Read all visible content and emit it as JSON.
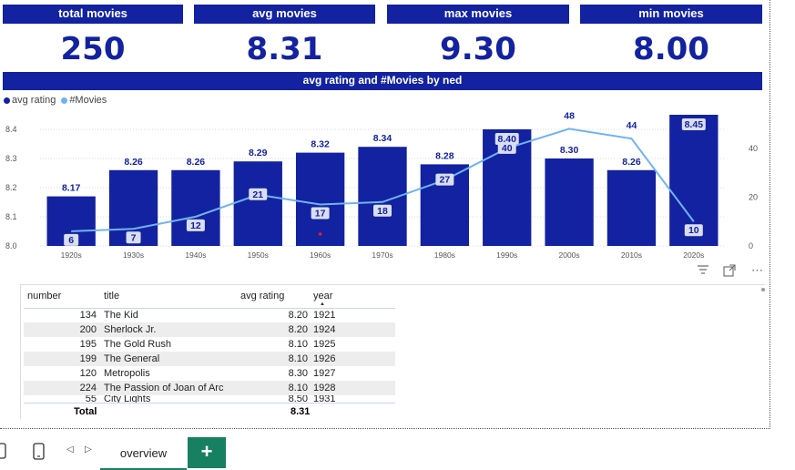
{
  "kpis": [
    {
      "label": "total movies",
      "value": "250"
    },
    {
      "label": "avg movies",
      "value": "8.31"
    },
    {
      "label": "max movies",
      "value": "9.30"
    },
    {
      "label": "min movies",
      "value": "8.00"
    }
  ],
  "chart_data": {
    "type": "bar",
    "title": "avg rating and #Movies by ned",
    "categories": [
      "1920s",
      "1930s",
      "1940s",
      "1950s",
      "1960s",
      "1970s",
      "1980s",
      "1990s",
      "2000s",
      "2010s",
      "2020s"
    ],
    "series": [
      {
        "name": "avg rating",
        "kind": "bar",
        "axis": "left",
        "values": [
          8.17,
          8.26,
          8.26,
          8.29,
          8.32,
          8.34,
          8.28,
          8.4,
          8.3,
          8.26,
          8.45
        ],
        "labels": [
          "8.17",
          "8.26",
          "8.26",
          "8.29",
          "8.32",
          "8.34",
          "8.28",
          "8.40",
          "8.30",
          "8.26",
          "8.45"
        ]
      },
      {
        "name": "#Movies",
        "kind": "line",
        "axis": "right",
        "values": [
          6,
          7,
          12,
          21,
          17,
          18,
          27,
          40,
          48,
          44,
          10
        ]
      }
    ],
    "y_left": {
      "min": 8.0,
      "max": 8.45,
      "ticks": [
        "8.0",
        "8.1",
        "8.2",
        "8.3",
        "8.4"
      ]
    },
    "y_right": {
      "min": 0,
      "max": 56,
      "ticks": [
        "0",
        "20",
        "40"
      ]
    },
    "legend_position": "top-left",
    "grid": true,
    "colors": {
      "bar": "#1322a0",
      "line": "#6fb3f2",
      "label": "#1322a0"
    }
  },
  "legend": [
    "avg rating",
    "#Movies"
  ],
  "table": {
    "columns": [
      "number",
      "title",
      "avg rating",
      "year"
    ],
    "rows": [
      [
        "134",
        "The Kid",
        "8.20",
        "1921"
      ],
      [
        "200",
        "Sherlock Jr.",
        "8.20",
        "1924"
      ],
      [
        "195",
        "The Gold Rush",
        "8.10",
        "1925"
      ],
      [
        "199",
        "The General",
        "8.10",
        "1926"
      ],
      [
        "120",
        "Metropolis",
        "8.30",
        "1927"
      ],
      [
        "224",
        "The Passion of Joan of Arc",
        "8.10",
        "1928"
      ],
      [
        "55",
        "City Lights",
        "8.50",
        "1931"
      ]
    ],
    "total_label": "Total",
    "total_value": "8.31"
  },
  "tabs": {
    "page": "overview",
    "add": "+"
  },
  "icons": {
    "filter": "filter-icon",
    "focus": "focus-mode-icon",
    "more": "more-options-icon"
  }
}
